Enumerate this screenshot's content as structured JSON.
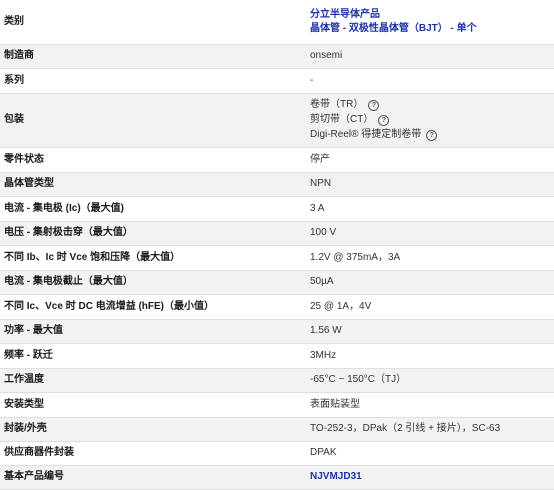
{
  "rows": [
    {
      "label": "类别",
      "value_line1": "分立半导体产品",
      "value_line2": "晶体管 - 双极性晶体管（BJT） - 单个"
    },
    {
      "label": "制造商",
      "value": "onsemi"
    },
    {
      "label": "系列",
      "value": "-"
    },
    {
      "label": "包装",
      "packaging": [
        "卷带（TR）",
        "剪切带（CT）",
        "Digi-Reel® 得捷定制卷带"
      ]
    },
    {
      "label": "零件状态",
      "value": "停产"
    },
    {
      "label": "晶体管类型",
      "value": "NPN"
    },
    {
      "label": "电流 - 集电极 (Ic)（最大值)",
      "value": "3 A"
    },
    {
      "label": "电压 - 集射极击穿（最大值）",
      "value": "100 V"
    },
    {
      "label": "不同 Ib、Ic 时 Vce 饱和压降（最大值）",
      "value": "1.2V @ 375mA，3A"
    },
    {
      "label": "电流 - 集电极截止（最大值）",
      "value": "50µA"
    },
    {
      "label": "不同 Ic、Vce 时 DC 电流增益 (hFE)（最小值）",
      "value": "25 @ 1A，4V"
    },
    {
      "label": "功率 - 最大值",
      "value": "1.56 W"
    },
    {
      "label": "频率 - 跃迁",
      "value": "3MHz"
    },
    {
      "label": "工作温度",
      "value": "-65°C ~ 150°C（TJ）"
    },
    {
      "label": "安装类型",
      "value": "表面贴装型"
    },
    {
      "label": "封装/外壳",
      "value": "TO-252-3，DPak（2 引线 + 接片），SC-63"
    },
    {
      "label": "供应商器件封装",
      "value": "DPAK"
    },
    {
      "label": "基本产品编号",
      "value": "NJVMJD31"
    }
  ],
  "icons": {
    "help": "question-circle-icon",
    "help_glyph": "?"
  }
}
